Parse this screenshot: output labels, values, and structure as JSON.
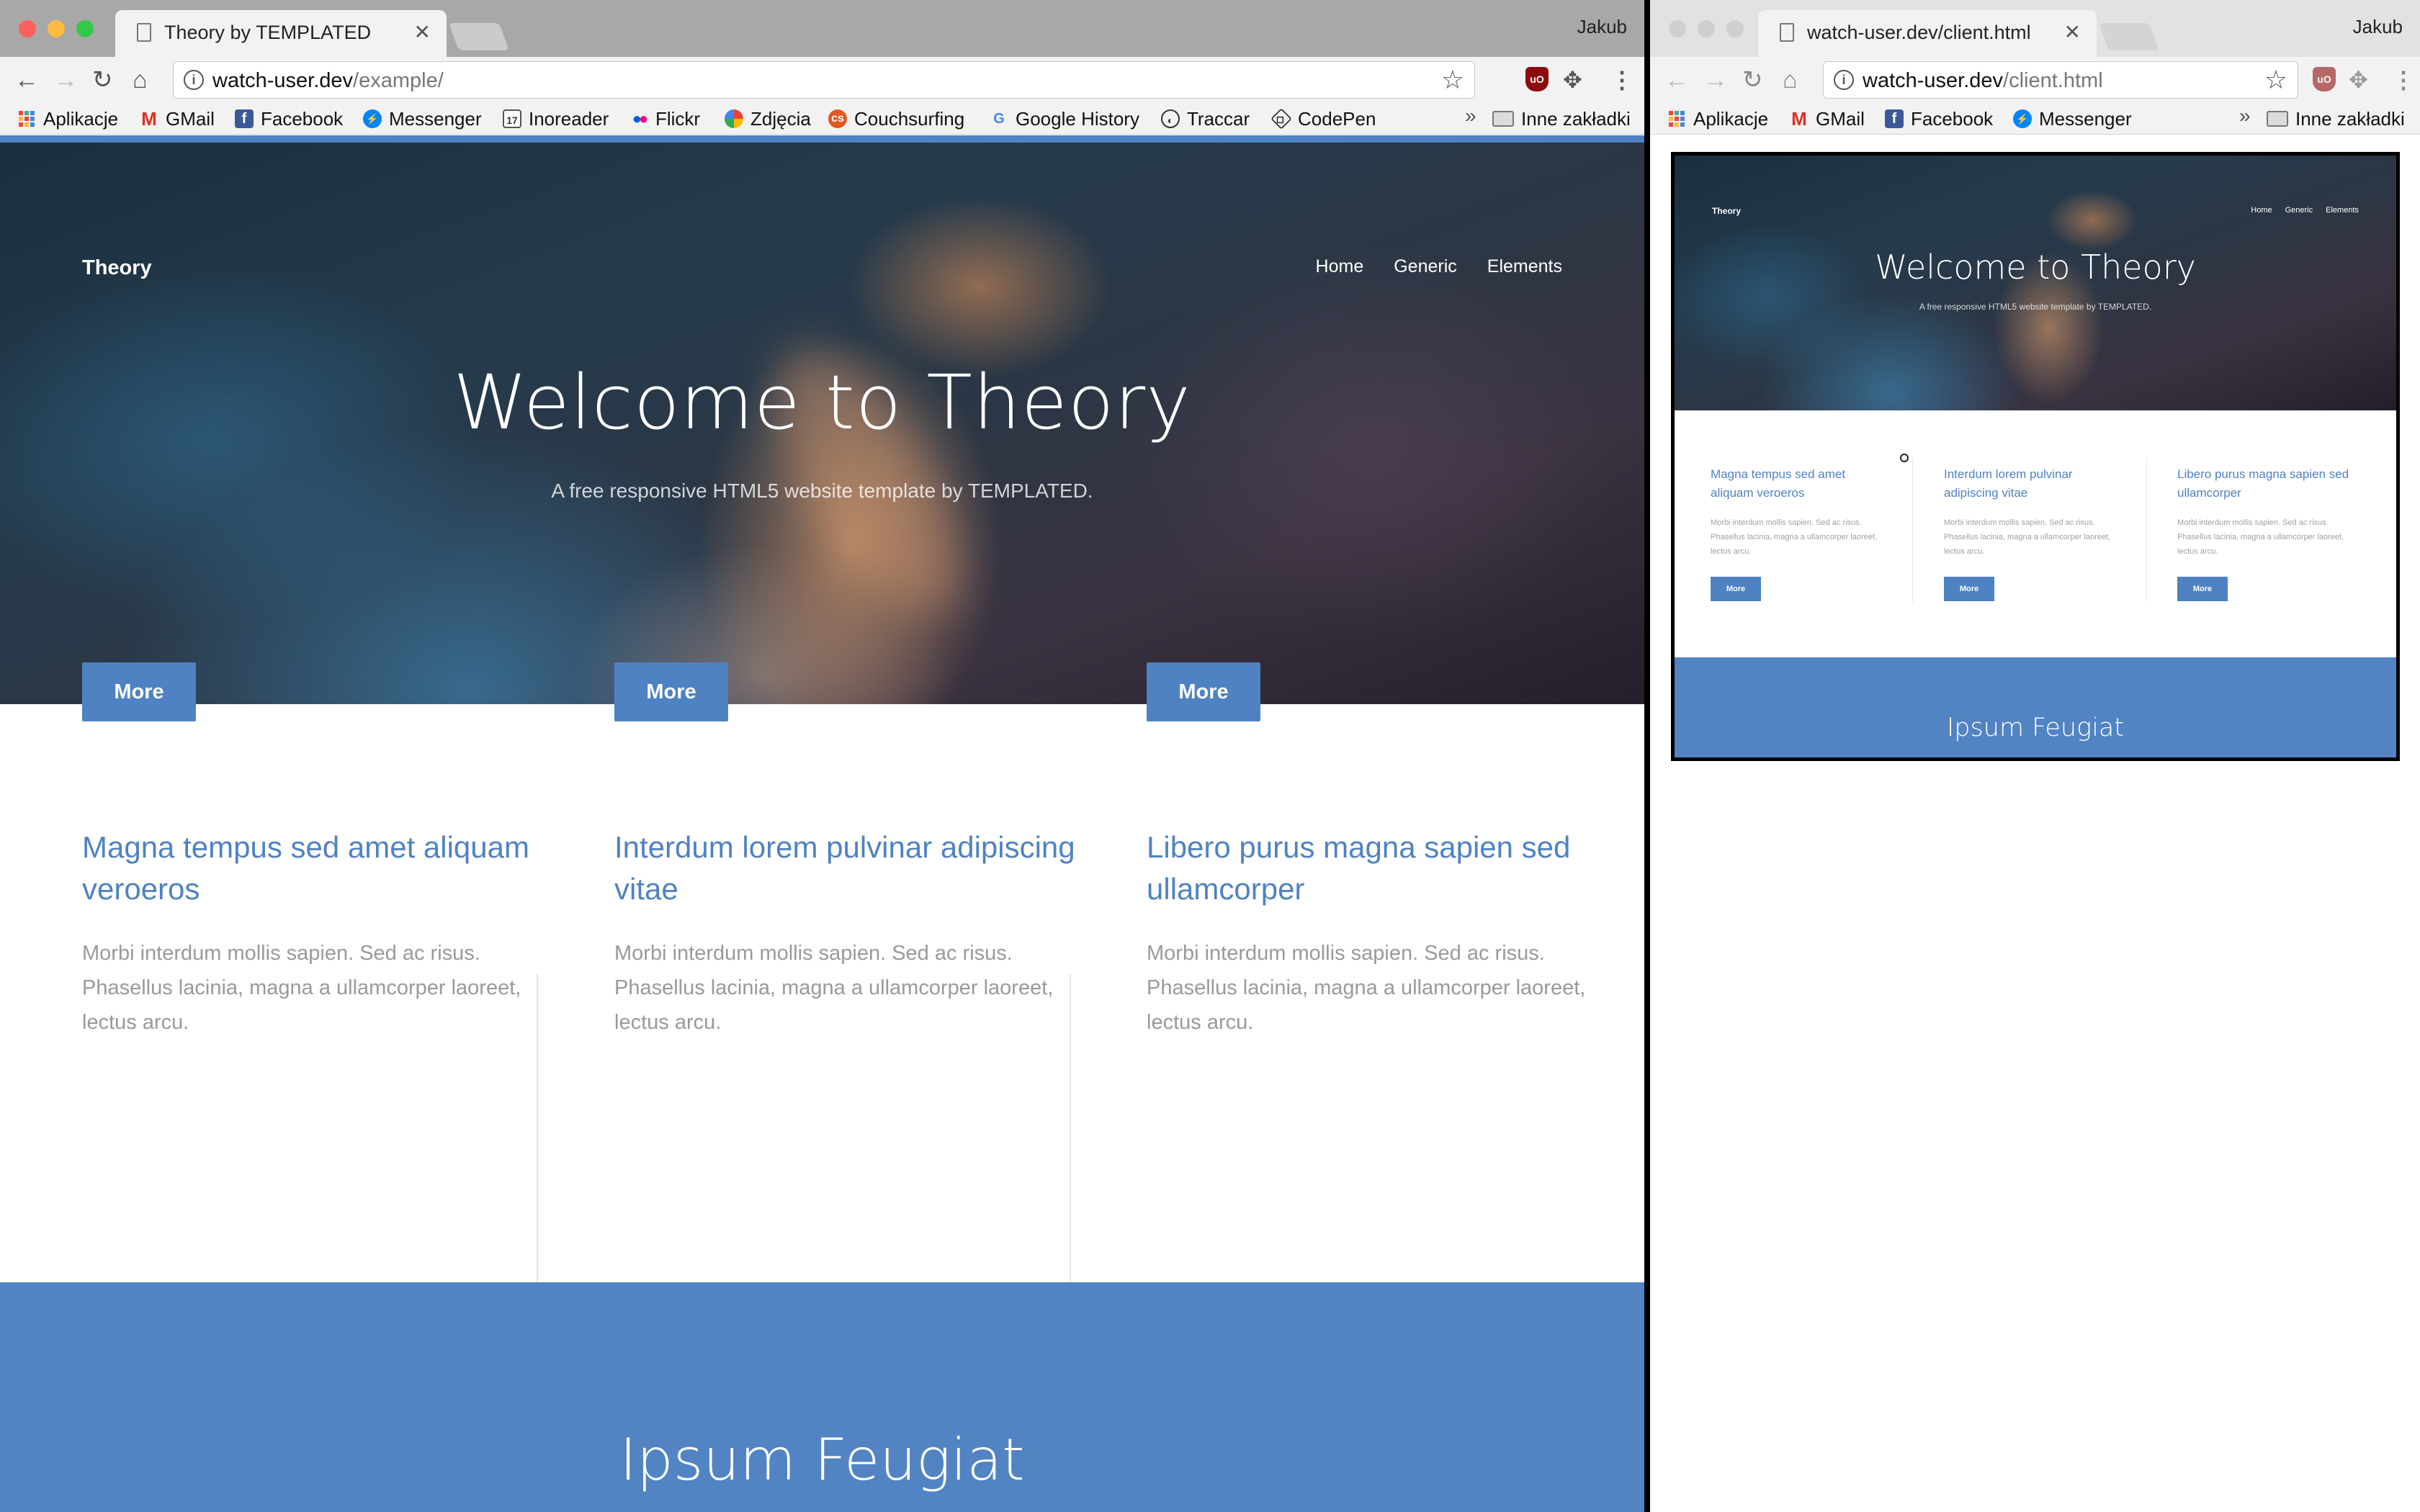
{
  "left_window": {
    "tab_title": "Theory by TEMPLATED",
    "profile": "Jakub",
    "url_host": "watch-user.dev",
    "url_path": "/example/",
    "bookmarks": [
      "Aplikacje",
      "GMail",
      "Facebook",
      "Messenger",
      "Inoreader",
      "Flickr",
      "Zdjęcia",
      "Couchsurfing",
      "Google History",
      "Traccar",
      "CodePen"
    ],
    "bookmarks_more": "»",
    "other_bookmarks": "Inne zakładki"
  },
  "right_window": {
    "tab_title": "watch-user.dev/client.html",
    "profile": "Jakub",
    "url_host": "watch-user.dev",
    "url_path": "/client.html",
    "bookmarks": [
      "Aplikacje",
      "GMail",
      "Facebook",
      "Messenger"
    ],
    "bookmarks_more": "»",
    "other_bookmarks": "Inne zakładki"
  },
  "site": {
    "logo": "Theory",
    "nav": [
      "Home",
      "Generic",
      "Elements"
    ],
    "hero_title": "Welcome to Theory",
    "hero_subtitle": "A free responsive HTML5 website template by TEMPLATED.",
    "features": [
      {
        "title": "Magna tempus sed amet aliquam veroeros",
        "text": "Morbi interdum mollis sapien. Sed ac risus. Phasellus lacinia, magna a ullamcorper laoreet, lectus arcu.",
        "button": "More"
      },
      {
        "title": "Interdum lorem pulvinar adipiscing vitae",
        "text": "Morbi interdum mollis sapien. Sed ac risus. Phasellus lacinia, magna a ullamcorper laoreet, lectus arcu.",
        "button": "More"
      },
      {
        "title": "Libero purus magna sapien sed ullamcorper",
        "text": "Morbi interdum mollis sapien. Sed ac risus. Phasellus lacinia, magna a ullamcorper laoreet, lectus arcu.",
        "button": "More"
      }
    ],
    "band_title": "Ipsum Feugiat"
  },
  "colors": {
    "accent": "#4f82c2",
    "band": "#5284c4"
  }
}
